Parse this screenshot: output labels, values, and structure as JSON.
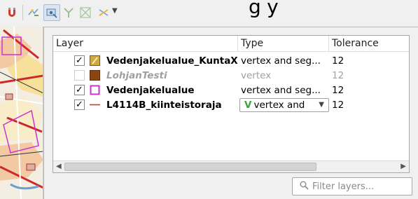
{
  "toolbar": {
    "partial_text": "g    y",
    "buttons": [
      {
        "icon": "magnet-snapping-icon",
        "pressed": false
      },
      {
        "icon": "snap-to-layer-icon",
        "pressed": false
      },
      {
        "icon": "advanced-configuration-icon",
        "pressed": true
      },
      {
        "icon": "topological-editing-icon",
        "pressed": false
      },
      {
        "icon": "avoid-overlap-icon",
        "pressed": false
      },
      {
        "icon": "intersection-snapping-icon",
        "pressed": false
      }
    ]
  },
  "table": {
    "headers": {
      "layer": "Layer",
      "type": "Type",
      "tolerance": "Tolerance"
    },
    "rows": [
      {
        "name": "Vedenjakelualue_KuntaX",
        "type": "vertex and seg...",
        "tolerance": "12",
        "checked": true,
        "enabled": true,
        "symbol": "line-pattern",
        "symbol_color": "#c8a23a"
      },
      {
        "name": "LohjanTesti",
        "type": "vertex",
        "tolerance": "12",
        "checked": false,
        "enabled": false,
        "symbol": "fill",
        "symbol_color": "#8b4513"
      },
      {
        "name": "Vedenjakelualue",
        "type": "vertex and seg...",
        "tolerance": "12",
        "checked": true,
        "enabled": true,
        "symbol": "outline",
        "symbol_color": "#cc33cc"
      },
      {
        "name": "L4114B_kiinteistoraja",
        "type": "vertex and",
        "tolerance": "12",
        "checked": true,
        "enabled": true,
        "symbol": "line",
        "symbol_color": "#d9342b",
        "editing": true
      }
    ]
  },
  "filter": {
    "placeholder": "Filter layers..."
  }
}
